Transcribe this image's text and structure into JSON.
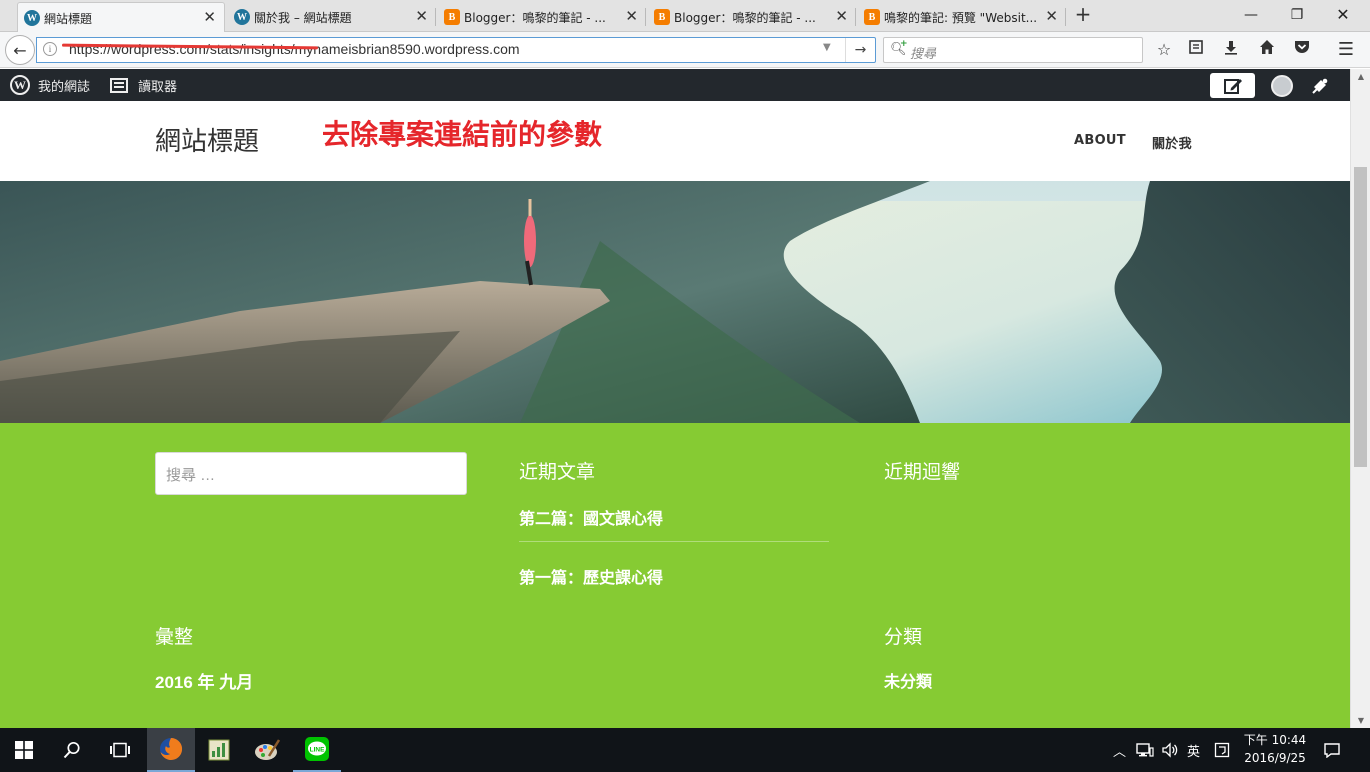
{
  "browser": {
    "tabs": [
      {
        "title": "網站標題",
        "favicon": "wordpress-icon",
        "active": true
      },
      {
        "title": "關於我 – 網站標題",
        "favicon": "wordpress-icon",
        "active": false
      },
      {
        "title": "Blogger：鳴黎的筆記 - ...",
        "favicon": "blogger-icon",
        "active": false
      },
      {
        "title": "Blogger：鳴黎的筆記 - ...",
        "favicon": "blogger-icon",
        "active": false
      },
      {
        "title": "鳴黎的筆記: 預覽 \"Websit...",
        "favicon": "blogger-icon",
        "active": false
      }
    ],
    "url": "https://wordpress.com/stats/insights/mynameisbrian8590.wordpress.com",
    "search_placeholder": "搜尋",
    "accent_color": "#5b9bd5"
  },
  "admin_bar": {
    "my_site": "我的網誌",
    "reader": "讀取器",
    "bg_color": "#23282d"
  },
  "site": {
    "title": "網站標題",
    "annotation": "去除專案連結前的參數",
    "annotation_color": "#e5262b",
    "menu": [
      "ABOUT",
      "關於我"
    ]
  },
  "widgets": {
    "bg_color": "#86cb33",
    "search_placeholder": "搜尋 …",
    "recent_posts_title": "近期文章",
    "recent_posts": [
      "第二篇：國文課心得",
      "第一篇：歷史課心得"
    ],
    "recent_comments_title": "近期迴響",
    "archives_title": "彙整",
    "archives": [
      "2016 年 九月"
    ],
    "categories_title": "分類",
    "categories": [
      "未分類"
    ]
  },
  "taskbar": {
    "tray_ime": "英",
    "time": "下午 10:44",
    "date": "2016/9/25"
  }
}
